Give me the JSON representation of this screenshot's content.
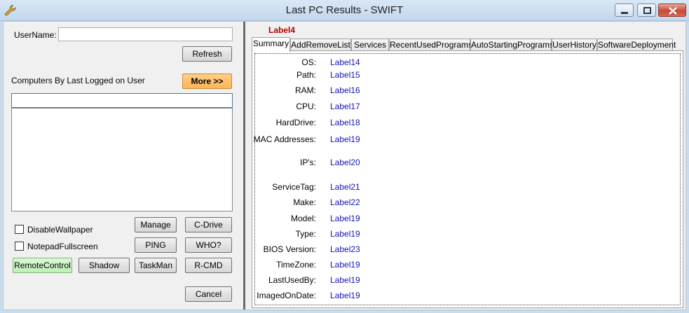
{
  "window": {
    "title": "Last PC Results - SWIFT",
    "icon": "wrench-icon",
    "controls": {
      "minimize": "minimize-icon",
      "maximize": "maximize-icon",
      "close": "close-icon"
    }
  },
  "left": {
    "username_label": "UserName:",
    "username_value": "",
    "refresh_label": "Refresh",
    "computers_label": "Computers By Last Logged on User",
    "more_label": "More >>",
    "computers_filter_value": "",
    "computers_list": [],
    "options": [
      {
        "label": "DisableWallpaper",
        "checked": false
      },
      {
        "label": "NotepadFullscreen",
        "checked": false
      }
    ],
    "buttons": {
      "manage": "Manage",
      "cdrive": "C-Drive",
      "ping": "PING",
      "who": "WHO?",
      "remote_control": "RemoteControl",
      "shadow": "Shadow",
      "taskman": "TaskMan",
      "rcmd": "R-CMD",
      "cancel": "Cancel"
    }
  },
  "right": {
    "header_label": "Label4",
    "tabs": [
      {
        "label": "Summary",
        "active": true
      },
      {
        "label": "AddRemoveList",
        "active": false
      },
      {
        "label": "Services",
        "active": false
      },
      {
        "label": "RecentUsedPrograms",
        "active": false
      },
      {
        "label": "AutoStartingPrograms",
        "active": false
      },
      {
        "label": "UserHistory",
        "active": false
      },
      {
        "label": "SoftwareDeployment",
        "active": false
      }
    ],
    "summary": [
      {
        "label": "OS:",
        "value": "Label14"
      },
      {
        "label": "Path:",
        "value": "Label15"
      },
      {
        "label": "RAM:",
        "value": "Label16"
      },
      {
        "label": "CPU:",
        "value": "Label17"
      },
      {
        "label": "HardDrive:",
        "value": "Label18"
      },
      {
        "label": "MAC Addresses:",
        "value": "Label19"
      },
      {
        "label": "IP's:",
        "value": "Label20"
      },
      {
        "label": "ServiceTag:",
        "value": "Label21"
      },
      {
        "label": "Make:",
        "value": "Label22"
      },
      {
        "label": "Model:",
        "value": "Label19"
      },
      {
        "label": "Type:",
        "value": "Label19"
      },
      {
        "label": "BIOS Version:",
        "value": "Label23"
      },
      {
        "label": "TimeZone:",
        "value": "Label19"
      },
      {
        "label": "LastUsedBy:",
        "value": "Label19"
      },
      {
        "label": "ImagedOnDate:",
        "value": "Label19"
      }
    ]
  },
  "colors": {
    "value_text": "#1515b8",
    "header_label": "#b40000",
    "more_button": "#ffb455",
    "remote_control_button": "#bff0b6"
  }
}
